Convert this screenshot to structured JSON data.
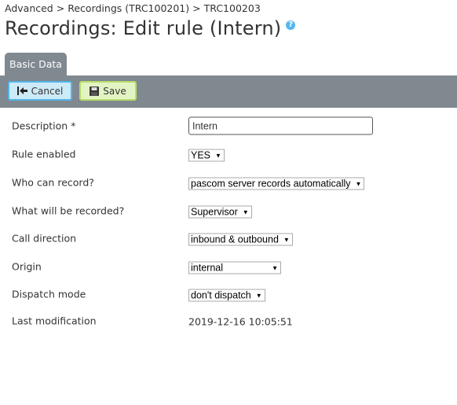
{
  "breadcrumb": {
    "items": [
      "Advanced",
      "Recordings (TRC100201)",
      "TRC100203"
    ],
    "separator": ">"
  },
  "page": {
    "title": "Recordings: Edit rule (Intern)",
    "help_icon": "help-question-icon"
  },
  "tabs": [
    {
      "label": "Basic Data",
      "active": true
    }
  ],
  "toolbar": {
    "cancel_label": "Cancel",
    "cancel_icon": "back-arrow-icon",
    "save_label": "Save",
    "save_icon": "floppy-disk-icon"
  },
  "form": {
    "description": {
      "label": "Description *",
      "value": "Intern"
    },
    "rule_enabled": {
      "label": "Rule enabled",
      "value": "YES"
    },
    "who_can_record": {
      "label": "Who can record?",
      "value": "pascom server records automatically"
    },
    "what_recorded": {
      "label": "What will be recorded?",
      "value": "Supervisor"
    },
    "call_direction": {
      "label": "Call direction",
      "value": "inbound & outbound"
    },
    "origin": {
      "label": "Origin",
      "value": "internal"
    },
    "dispatch_mode": {
      "label": "Dispatch mode",
      "value": "don't dispatch"
    },
    "last_modification": {
      "label": "Last modification",
      "value": "2019-12-16 10:05:51"
    }
  },
  "colors": {
    "toolbar_bg": "#808890",
    "cancel_bg": "#cdeaf8",
    "cancel_border": "#52b5e8",
    "save_bg": "#e3f4c4",
    "save_border": "#b6dd6a",
    "help_icon": "#56b7ee"
  }
}
